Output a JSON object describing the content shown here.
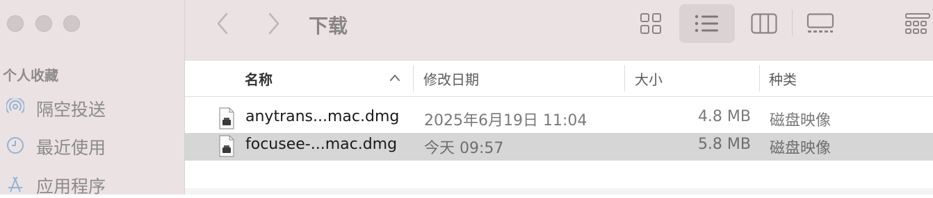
{
  "window": {
    "title": "下载"
  },
  "sidebar": {
    "section_title": "个人收藏",
    "items": [
      {
        "label": "隔空投送",
        "icon": "airdrop-icon"
      },
      {
        "label": "最近使用",
        "icon": "clock-icon"
      },
      {
        "label": "应用程序",
        "icon": "applications-icon"
      }
    ]
  },
  "toolbar": {
    "views": [
      "icon-view",
      "list-view",
      "column-view",
      "gallery-view"
    ],
    "active_view": "list-view"
  },
  "columns": {
    "name": "名称",
    "date": "修改日期",
    "size": "大小",
    "kind": "种类",
    "sort": "name-descending"
  },
  "files": [
    {
      "name": "anytrans...mac.dmg",
      "date": "2025年6月19日 11:04",
      "size": "4.8 MB",
      "kind": "磁盘映像",
      "selected": false
    },
    {
      "name": "focusee-...mac.dmg",
      "date": "今天 09:57",
      "size": "5.8 MB",
      "kind": "磁盘映像",
      "selected": true
    }
  ],
  "colors": {
    "sidebar_bg": "#ebe3e3",
    "selected_row": "#d6d6d6",
    "sidebar_icon": "#93b3d6"
  }
}
